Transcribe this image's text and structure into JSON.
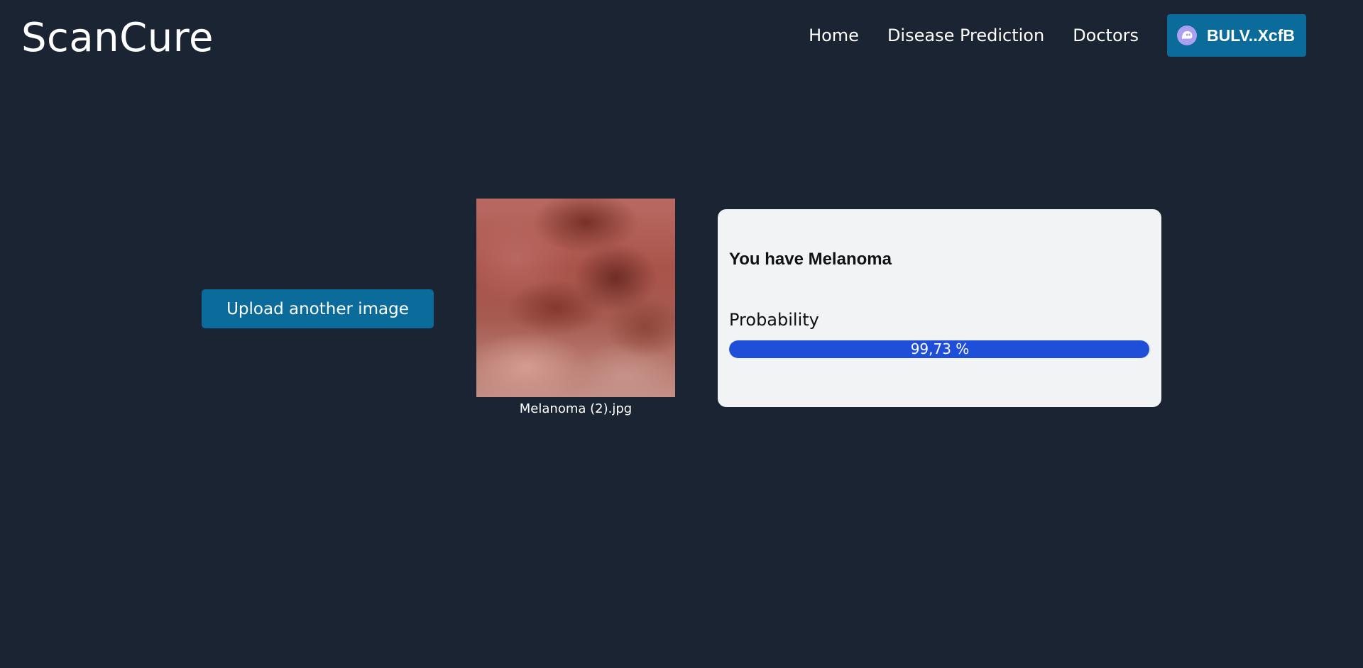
{
  "header": {
    "brand": "ScanCure",
    "nav": [
      {
        "label": "Home"
      },
      {
        "label": "Disease Prediction"
      },
      {
        "label": "Doctors"
      }
    ],
    "wallet": {
      "label": "BULV..XcfB",
      "icon": "phantom-ghost-icon"
    }
  },
  "main": {
    "upload_button": "Upload another image",
    "preview": {
      "file_name": "Melanoma (2).jpg"
    },
    "result": {
      "title": "You have Melanoma",
      "probability_label": "Probability",
      "probability_text": "99,73 %",
      "probability_value": 0.9973
    }
  },
  "colors": {
    "background": "#1b2432",
    "primary_button": "#0b6b9a",
    "progress_bar": "#1f4fd8",
    "card": "#f2f3f5"
  }
}
